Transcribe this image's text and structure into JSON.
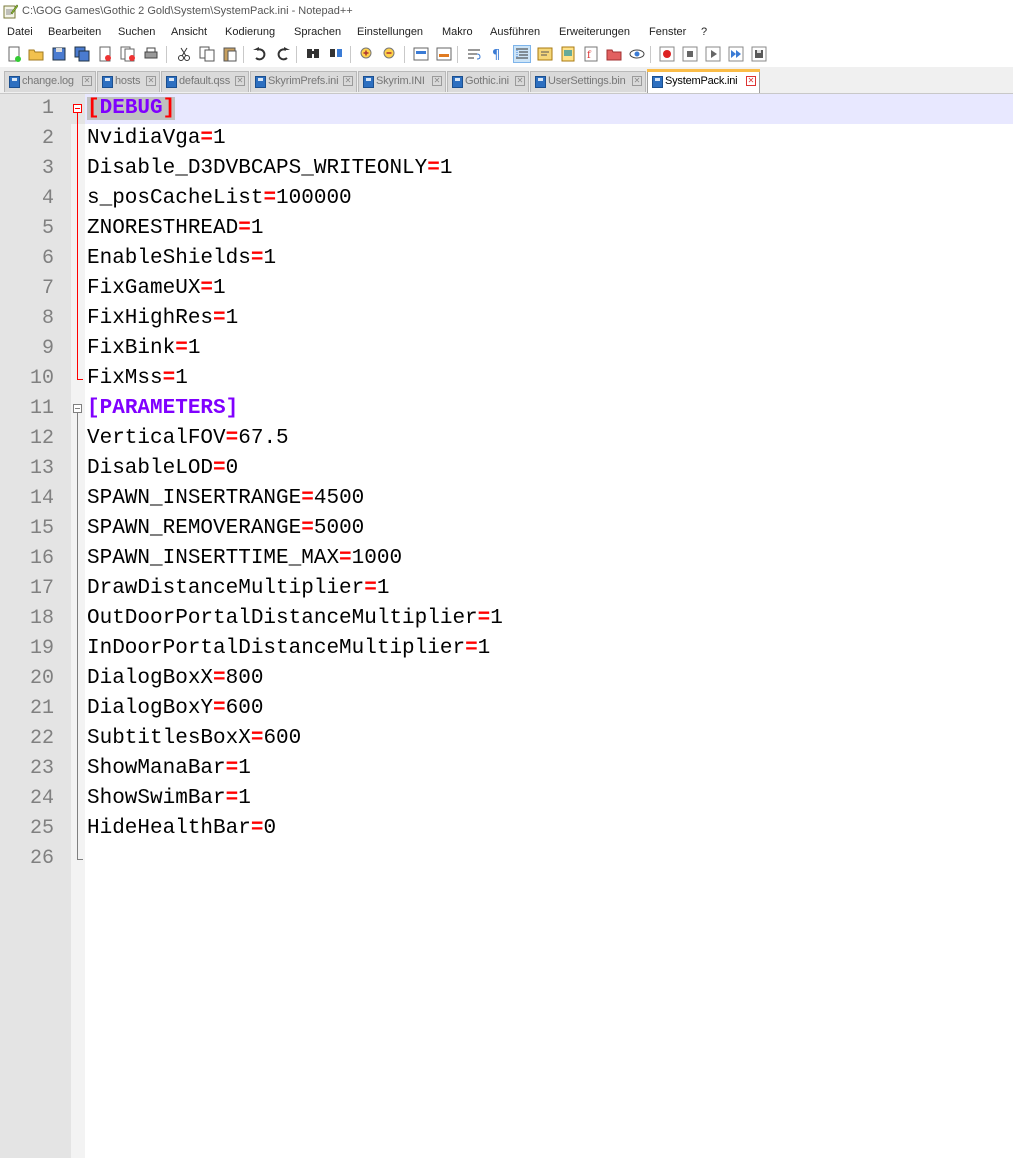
{
  "window": {
    "title": "C:\\GOG Games\\Gothic 2 Gold\\System\\SystemPack.ini - Notepad++"
  },
  "menu": [
    "Datei",
    "Bearbeiten",
    "Suchen",
    "Ansicht",
    "Kodierung",
    "Sprachen",
    "Einstellungen",
    "Makro",
    "Ausführen",
    "Erweiterungen",
    "Fenster",
    "?"
  ],
  "toolbar": {
    "icons": [
      "new-file-icon",
      "open-file-icon",
      "save-icon",
      "save-all-icon",
      "close-icon",
      "close-all-icon",
      "print-icon",
      "cut-icon",
      "copy-icon",
      "paste-icon",
      "undo-icon",
      "redo-icon",
      "find-icon",
      "replace-icon",
      "zoom-in-icon",
      "zoom-out-icon",
      "sync-vertical-icon",
      "sync-horizontal-icon",
      "word-wrap-icon",
      "show-all-chars-icon",
      "indent-guide-icon",
      "lang-udl-icon",
      "document-map-icon",
      "function-list-icon",
      "folder-workspace-icon",
      "monitoring-icon",
      "record-macro-icon",
      "stop-record-icon",
      "play-macro-icon",
      "run-macro-multiple-icon",
      "save-macro-icon"
    ],
    "active_icon": "indent-guide-icon"
  },
  "tabs": [
    {
      "label": "change.log",
      "active": false
    },
    {
      "label": "hosts",
      "active": false
    },
    {
      "label": "default.qss",
      "active": false
    },
    {
      "label": "SkyrimPrefs.ini",
      "active": false
    },
    {
      "label": "Skyrim.INI",
      "active": false
    },
    {
      "label": "Gothic.ini",
      "active": false
    },
    {
      "label": "UserSettings.bin",
      "active": false
    },
    {
      "label": "SystemPack.ini",
      "active": true
    }
  ],
  "editor": {
    "current_line": 1,
    "lines": [
      {
        "n": "1",
        "type": "section",
        "name": "DEBUG"
      },
      {
        "n": "2",
        "type": "kv",
        "key": "NvidiaVga",
        "value": "1"
      },
      {
        "n": "3",
        "type": "kv",
        "key": "Disable_D3DVBCAPS_WRITEONLY",
        "value": "1"
      },
      {
        "n": "4",
        "type": "kv",
        "key": "s_posCacheList",
        "value": "100000"
      },
      {
        "n": "5",
        "type": "kv",
        "key": "ZNORESTHREAD",
        "value": "1"
      },
      {
        "n": "6",
        "type": "kv",
        "key": "EnableShields",
        "value": "1"
      },
      {
        "n": "7",
        "type": "kv",
        "key": "FixGameUX",
        "value": "1"
      },
      {
        "n": "8",
        "type": "kv",
        "key": "FixHighRes",
        "value": "1"
      },
      {
        "n": "9",
        "type": "kv",
        "key": "FixBink",
        "value": "1"
      },
      {
        "n": "10",
        "type": "kv",
        "key": "FixMss",
        "value": "1"
      },
      {
        "n": "11",
        "type": "section",
        "name": "PARAMETERS"
      },
      {
        "n": "12",
        "type": "kv",
        "key": "VerticalFOV",
        "value": "67.5"
      },
      {
        "n": "13",
        "type": "kv",
        "key": "DisableLOD",
        "value": "0"
      },
      {
        "n": "14",
        "type": "kv",
        "key": "SPAWN_INSERTRANGE",
        "value": "4500"
      },
      {
        "n": "15",
        "type": "kv",
        "key": "SPAWN_REMOVERANGE",
        "value": "5000"
      },
      {
        "n": "16",
        "type": "kv",
        "key": "SPAWN_INSERTTIME_MAX",
        "value": "1000"
      },
      {
        "n": "17",
        "type": "kv",
        "key": "DrawDistanceMultiplier",
        "value": "1"
      },
      {
        "n": "18",
        "type": "kv",
        "key": "OutDoorPortalDistanceMultiplier",
        "value": "1"
      },
      {
        "n": "19",
        "type": "kv",
        "key": "InDoorPortalDistanceMultiplier",
        "value": "1"
      },
      {
        "n": "20",
        "type": "kv",
        "key": "DialogBoxX",
        "value": "800"
      },
      {
        "n": "21",
        "type": "kv",
        "key": "DialogBoxY",
        "value": "600"
      },
      {
        "n": "22",
        "type": "kv",
        "key": "SubtitlesBoxX",
        "value": "600"
      },
      {
        "n": "23",
        "type": "kv",
        "key": "ShowManaBar",
        "value": "1"
      },
      {
        "n": "24",
        "type": "kv",
        "key": "ShowSwimBar",
        "value": "1"
      },
      {
        "n": "25",
        "type": "kv",
        "key": "HideHealthBar",
        "value": "0"
      },
      {
        "n": "26",
        "type": "empty"
      }
    ]
  },
  "colors": {
    "section_name": "#8000ff",
    "bracket": "#ff0000",
    "equals": "#ff0000",
    "fold_active": "#ff0000",
    "fold_inactive": "#808080",
    "active_tab_accent": "#fabc47"
  }
}
